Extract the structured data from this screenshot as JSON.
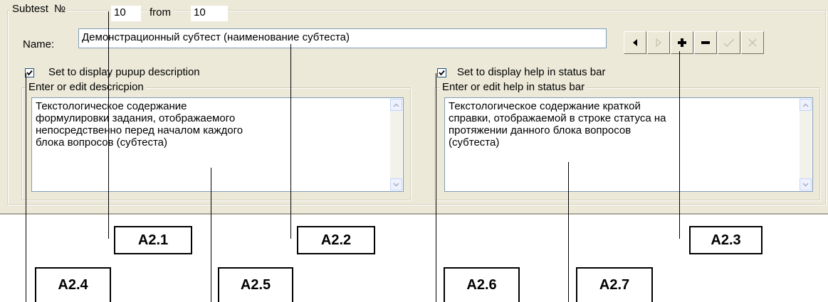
{
  "subtest": {
    "legend_label": "Subtest",
    "number_label": "№",
    "number_value": "10",
    "from_label": "from",
    "from_value": "10"
  },
  "name": {
    "label": "Name:",
    "value": "Демонстрационный субтест (наименование субтеста)"
  },
  "nav_buttons": [
    {
      "name": "prev",
      "icon": "triangle-left-icon",
      "enabled": true
    },
    {
      "name": "next",
      "icon": "triangle-right-icon",
      "enabled": false
    },
    {
      "name": "add",
      "icon": "plus-icon",
      "enabled": true
    },
    {
      "name": "delete",
      "icon": "minus-icon",
      "enabled": true
    },
    {
      "name": "post",
      "icon": "checkmark-icon",
      "enabled": false
    },
    {
      "name": "cancel",
      "icon": "cross-icon",
      "enabled": false
    }
  ],
  "popup": {
    "checkbox_label": "Set to display pupup description",
    "checked": true,
    "group_label": "Enter or edit descricpion",
    "text_lines": [
      "Текстологическое содержание",
      "формулировки задания, отображаемого",
      "непосредственно перед началом каждого",
      "блока вопросов (субтеста)"
    ]
  },
  "statusbar": {
    "checkbox_label": "Set to display help in status bar",
    "checked": true,
    "group_label": "Enter or edit help in status bar",
    "text_lines": [
      "Текстологическое содержание краткой",
      "справки, отображаемой в строке статуса на",
      "протяжении данного блока вопросов",
      "(субтеста)"
    ]
  },
  "callouts": [
    "A2.1",
    "A2.2",
    "A2.3",
    "A2.4",
    "A2.5",
    "A2.6",
    "A2.7"
  ],
  "colors": {
    "panel": "#ece9d8",
    "field_border": "#7f9db9",
    "disabled": "#c5c2b2"
  }
}
